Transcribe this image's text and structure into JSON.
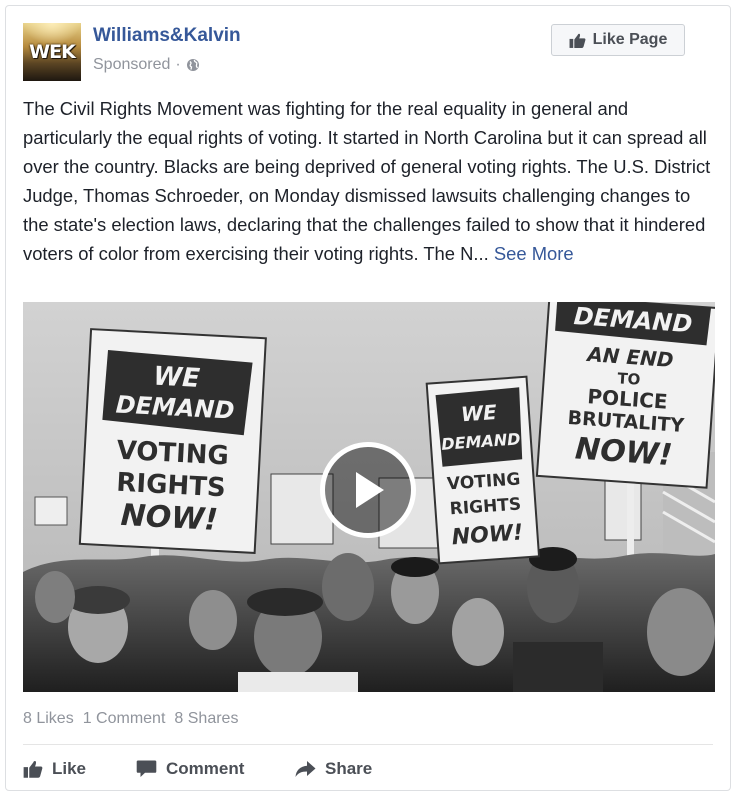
{
  "post": {
    "page_name": "Williams&Kalvin",
    "logo_text": "WEK",
    "sponsored_label": "Sponsored",
    "separator": "·",
    "like_page_label": "Like Page",
    "body_text": "The Civil Rights Movement was fighting for the real equality in general and particularly the equal rights of voting. It started in North Carolina but it can spread all over the country. Blacks are being deprived of general voting rights. The U.S. District Judge, Thomas Schroeder, on Monday dismissed lawsuits challenging changes to the state's election laws, declaring that the challenges failed to show that it hindered voters of color from exercising their voting rights. The N...",
    "see_more_label": "See More"
  },
  "media": {
    "signs": {
      "left_top": "WE",
      "left_mid": "DEMAND",
      "left_line1": "VOTING",
      "left_line2": "RIGHTS",
      "left_line3": "NOW!",
      "center_top": "WE",
      "center_mid": "DEMAND",
      "center_line1": "VOTING",
      "center_line2": "RIGHTS",
      "center_line3": "NOW!",
      "right_top": "DEMAND",
      "right_line1": "AN END",
      "right_line2": "TO",
      "right_line3": "POLICE",
      "right_line4": "BRUTALITY",
      "right_line5": "NOW!"
    }
  },
  "stats": {
    "likes": "8 Likes",
    "comments": "1 Comment",
    "shares": "8 Shares"
  },
  "actions": {
    "like": "Like",
    "comment": "Comment",
    "share": "Share"
  },
  "colors": {
    "link": "#365899",
    "secondary_text": "#90949c",
    "action_text": "#4b4f56"
  }
}
